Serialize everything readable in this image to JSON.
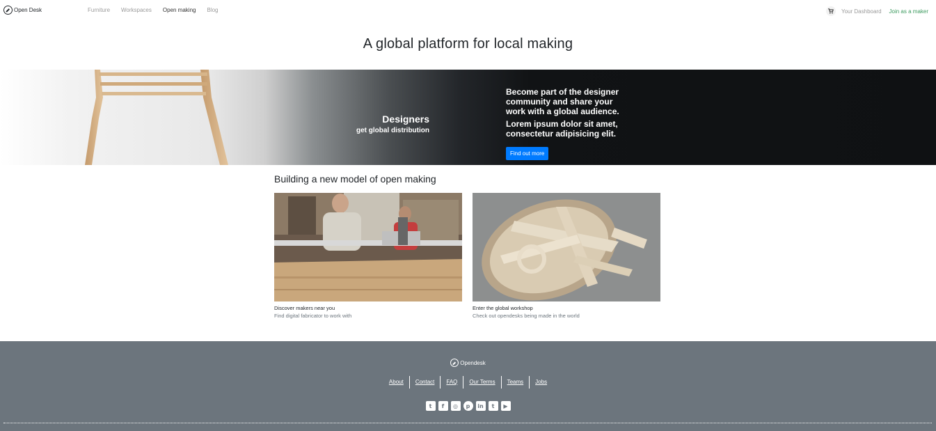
{
  "nav": {
    "brand": "Open Desk",
    "links": [
      "Furniture",
      "Workspaces",
      "Open making",
      "Blog"
    ],
    "active": "Open making",
    "cart_icon": "cart-icon",
    "dashboard": "Your Dashboard",
    "join": "Join as a maker"
  },
  "headline": "A global platform for local making",
  "hero": {
    "title": "Designers",
    "subtitle": "get global distribution",
    "text1": "Become part of the designer community and share your work with a global audience.",
    "text2": "Lorem ipsum dolor sit amet, consectetur adipisicing elit.",
    "button": "Find out more"
  },
  "section": {
    "title": "Building a new model of open making",
    "cards": [
      {
        "title": "Discover makers near you",
        "desc": "Find digital fabricator to work with"
      },
      {
        "title": "Enter the global workshop",
        "desc": "Check out opendesks being made in the world"
      }
    ]
  },
  "footer": {
    "brand": "Opendesk",
    "links": [
      "About",
      "Contact",
      "FAQ",
      "Our Terms",
      "Teams",
      "Jobs"
    ],
    "social": [
      {
        "name": "twitter-icon",
        "glyph": "t"
      },
      {
        "name": "facebook-icon",
        "glyph": "f"
      },
      {
        "name": "instagram-icon",
        "glyph": "◎"
      },
      {
        "name": "pinterest-icon",
        "glyph": "p"
      },
      {
        "name": "linkedin-icon",
        "glyph": "in"
      },
      {
        "name": "tumblr-icon",
        "glyph": "t"
      },
      {
        "name": "youtube-icon",
        "glyph": "▶"
      }
    ]
  },
  "colors": {
    "footer_bg": "#6c757d",
    "button": "#007bff",
    "join_link": "#3c9a5f"
  }
}
